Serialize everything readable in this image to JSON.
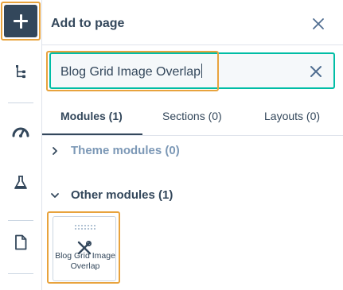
{
  "rail": {
    "items": [
      {
        "icon": "plus-icon",
        "active": true
      },
      {
        "icon": "tree-structure-icon"
      },
      {
        "icon": "gauge-icon"
      },
      {
        "icon": "flask-icon"
      },
      {
        "icon": "document-icon"
      }
    ]
  },
  "panel": {
    "title": "Add to page",
    "close_icon": "close-icon"
  },
  "search": {
    "value": "Blog Grid Image Overlap",
    "clear_icon": "close-icon"
  },
  "tabs": [
    {
      "label": "Modules (1)",
      "active": true
    },
    {
      "label": "Sections (0)",
      "active": false
    },
    {
      "label": "Layouts (0)",
      "active": false
    }
  ],
  "groups": [
    {
      "label": "Theme modules (0)",
      "expanded": false
    },
    {
      "label": "Other modules (1)",
      "expanded": true
    }
  ],
  "modules": [
    {
      "label": "Blog Grid Image Overlap",
      "icon": "wrench-screwdriver-icon"
    }
  ],
  "colors": {
    "accent": "#00bda5",
    "highlight": "#e8a33d",
    "text": "#33475b",
    "muted": "#7c98b6"
  }
}
